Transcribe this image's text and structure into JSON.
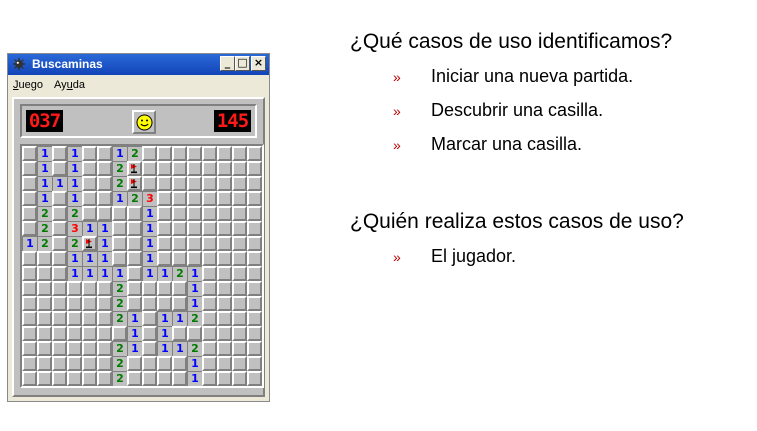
{
  "window": {
    "title": "Buscaminas",
    "menu": [
      {
        "before": "",
        "underlined": "J",
        "after": "uego"
      },
      {
        "before": "Ay",
        "underlined": "u",
        "after": "da"
      }
    ],
    "buttons": {
      "minimize": "_",
      "maximize": "□",
      "close": "×"
    }
  },
  "game": {
    "mines_counter": "037",
    "timer": "145",
    "smiley_icon": "smiley-face-icon",
    "colors": {
      "1": "#0000ff",
      "2": "#007b00",
      "3": "#ff0000",
      "flag": "#ff0000"
    },
    "board": [
      [
        "h",
        "1",
        "h",
        "1",
        "h",
        "h",
        "1",
        "2",
        "h",
        "h",
        "h",
        "h",
        "h",
        "h",
        "h",
        "h"
      ],
      [
        "h",
        "1",
        "h",
        "1",
        "h",
        "h",
        "2",
        "F",
        "h",
        "h",
        "h",
        "h",
        "h",
        "h",
        "h",
        "h"
      ],
      [
        "h",
        "1",
        "1",
        "1",
        "h",
        "h",
        "2",
        "F",
        "h",
        "h",
        "h",
        "h",
        "h",
        "h",
        "h",
        "h"
      ],
      [
        "h",
        "1",
        "h",
        "1",
        "h",
        "h",
        "1",
        "2",
        "3",
        "h",
        "h",
        "h",
        "h",
        "h",
        "h",
        "h"
      ],
      [
        "h",
        "2",
        "h",
        "2",
        "h",
        "h",
        "h",
        "h",
        "1",
        "h",
        "h",
        "h",
        "h",
        "h",
        "h",
        "h"
      ],
      [
        "h",
        "2",
        "h",
        "3",
        "1",
        "1",
        "h",
        "h",
        "1",
        "h",
        "h",
        "h",
        "h",
        "h",
        "h",
        "h"
      ],
      [
        "1",
        "2",
        "h",
        "2",
        "F",
        "1",
        "h",
        "h",
        "1",
        "h",
        "h",
        "h",
        "h",
        "h",
        "h",
        "h"
      ],
      [
        "h",
        "h",
        "h",
        "1",
        "1",
        "1",
        "h",
        "h",
        "1",
        "h",
        "h",
        "h",
        "h",
        "h",
        "h",
        "h"
      ],
      [
        "h",
        "h",
        "h",
        "1",
        "1",
        "1",
        "1",
        "h",
        "1",
        "1",
        "2",
        "1",
        "h",
        "h",
        "h",
        "h"
      ],
      [
        "h",
        "h",
        "h",
        "h",
        "h",
        "h",
        "2",
        "h",
        "h",
        "h",
        "h",
        "1",
        "h",
        "h",
        "h",
        "h"
      ],
      [
        "h",
        "h",
        "h",
        "h",
        "h",
        "h",
        "2",
        "h",
        "h",
        "h",
        "h",
        "1",
        "h",
        "h",
        "h",
        "h"
      ],
      [
        "h",
        "h",
        "h",
        "h",
        "h",
        "h",
        "2",
        "1",
        "h",
        "1",
        "1",
        "2",
        "h",
        "h",
        "h",
        "h"
      ],
      [
        "h",
        "h",
        "h",
        "h",
        "h",
        "h",
        "h",
        "1",
        "h",
        "1",
        "h",
        "h",
        "h",
        "h",
        "h",
        "h"
      ],
      [
        "h",
        "h",
        "h",
        "h",
        "h",
        "h",
        "2",
        "1",
        "h",
        "1",
        "1",
        "2",
        "h",
        "h",
        "h",
        "h"
      ],
      [
        "h",
        "h",
        "h",
        "h",
        "h",
        "h",
        "2",
        "h",
        "h",
        "h",
        "h",
        "1",
        "h",
        "h",
        "h",
        "h"
      ],
      [
        "h",
        "h",
        "h",
        "h",
        "h",
        "h",
        "2",
        "h",
        "h",
        "h",
        "h",
        "1",
        "h",
        "h",
        "h",
        "h"
      ]
    ]
  },
  "slide": {
    "q1": "¿Qué casos de uso identificamos?",
    "q1_items": [
      "Iniciar una nueva partida.",
      "Descubrir una casilla.",
      "Marcar una casilla."
    ],
    "q2": "¿Quién realiza estos casos de uso?",
    "q2_items": [
      "El jugador."
    ],
    "bullet_mark": "»"
  }
}
